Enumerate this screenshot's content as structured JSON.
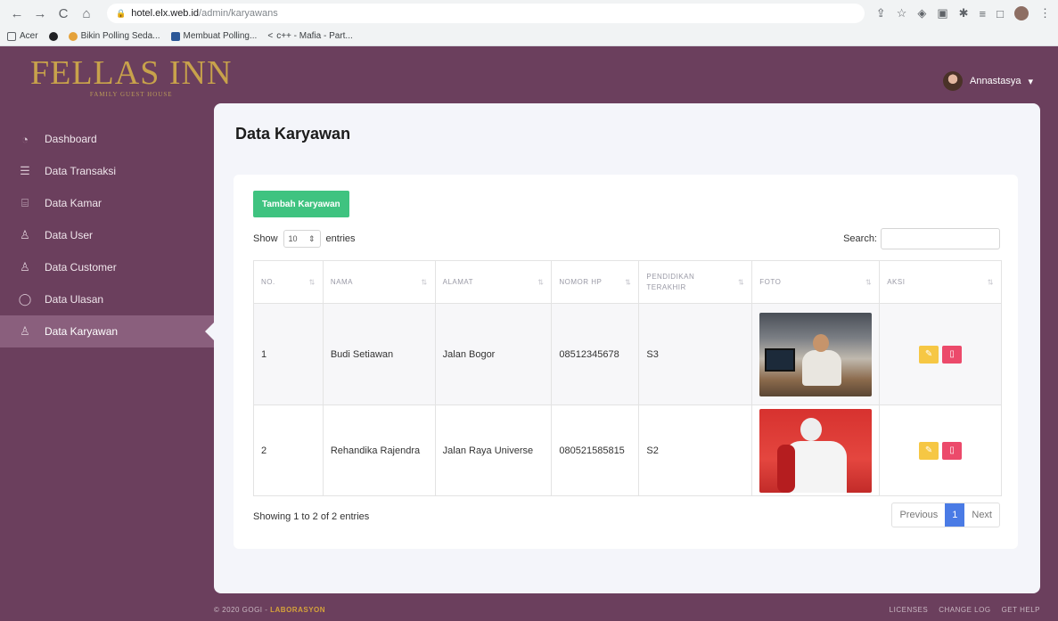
{
  "browser": {
    "url_host": "hotel.elx.web.id",
    "url_path": "/admin/karyawans",
    "bookmarks": [
      "Acer",
      "Bikin Polling Seda...",
      "Membuat Polling...",
      "c++ - Mafia - Part..."
    ]
  },
  "brand": {
    "name": "FELLAS INN",
    "tagline": "FAMILY GUEST HOUSE",
    "color": "#c8a24b"
  },
  "user": {
    "name": "Annastasya"
  },
  "sidebar": {
    "items": [
      {
        "label": "Dashboard",
        "icon": "pie-chart-icon"
      },
      {
        "label": "Data Transaksi",
        "icon": "list-icon"
      },
      {
        "label": "Data Kamar",
        "icon": "building-icon"
      },
      {
        "label": "Data User",
        "icon": "user-icon"
      },
      {
        "label": "Data Customer",
        "icon": "user-plus-icon"
      },
      {
        "label": "Data Ulasan",
        "icon": "chat-icon"
      },
      {
        "label": "Data Karyawan",
        "icon": "users-icon",
        "active": true
      }
    ]
  },
  "page": {
    "title": "Data Karyawan"
  },
  "toolbar": {
    "add_label": "Tambah Karyawan"
  },
  "length": {
    "show": "Show",
    "value": "10",
    "entries": "entries"
  },
  "search": {
    "label": "Search:"
  },
  "table": {
    "headers": [
      "NO.",
      "NAMA",
      "ALAMAT",
      "NOMOR HP",
      "PENDIDIKAN TERAKHIR",
      "FOTO",
      "AKSI"
    ],
    "rows": [
      {
        "no": "1",
        "nama": "Budi Setiawan",
        "alamat": "Jalan Bogor",
        "hp": "08512345678",
        "pendidikan": "S3"
      },
      {
        "no": "2",
        "nama": "Rehandika Rajendra",
        "alamat": "Jalan Raya Universe",
        "hp": "080521585815",
        "pendidikan": "S2"
      }
    ]
  },
  "info": "Showing 1 to 2 of 2 entries",
  "pager": {
    "prev": "Previous",
    "current": "1",
    "next": "Next"
  },
  "footer": {
    "copyright": "© 2020 GOGI - ",
    "company": "LABORASYON",
    "links": [
      "LICENSES",
      "CHANGE LOG",
      "GET HELP"
    ]
  },
  "colors": {
    "sidebar_bg": "#6b3f5d",
    "active_item": "#8a5f7d",
    "add_button": "#3fc380",
    "edit_button": "#f6c744",
    "delete_button": "#ec4a6b",
    "pager_current": "#4a7be5"
  }
}
